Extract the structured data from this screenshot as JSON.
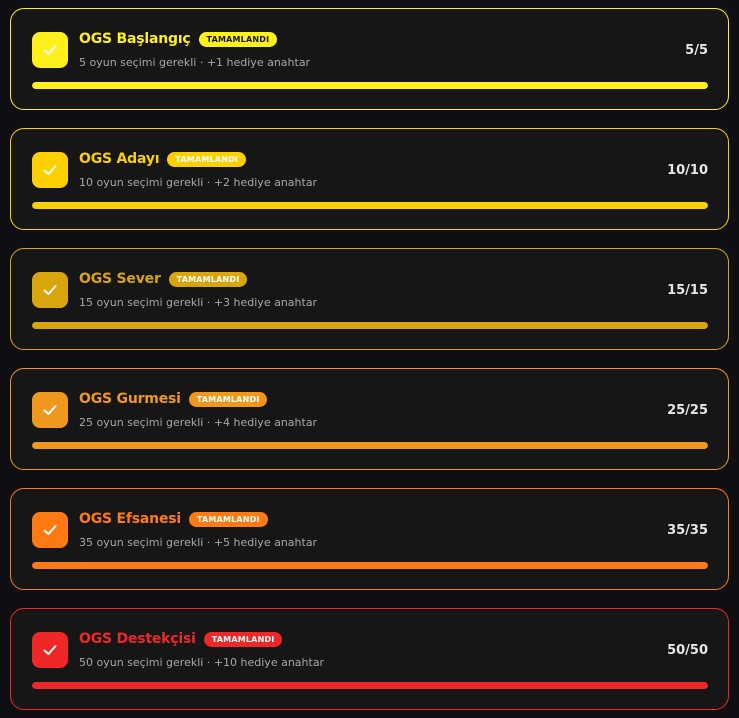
{
  "badge_label": "TAMAMLANDI",
  "levels": [
    {
      "title": "OGS Başlangıç",
      "subtitle": "5 oyun seçimi gerekli · +1 hediye anahtar",
      "count": "5/5",
      "progress": 1.0,
      "color": "#ffef1a",
      "badge_text_color": "#161616"
    },
    {
      "title": "OGS Adayı",
      "subtitle": "10 oyun seçimi gerekli · +2 hediye anahtar",
      "count": "10/10",
      "progress": 1.0,
      "color": "#ffd000",
      "badge_text_color": "#ffffff"
    },
    {
      "title": "OGS Sever",
      "subtitle": "15 oyun seçimi gerekli · +3 hediye anahtar",
      "count": "15/15",
      "progress": 1.0,
      "color": "#d9a50c",
      "badge_text_color": "#ffffff"
    },
    {
      "title": "OGS Gurmesi",
      "subtitle": "25 oyun seçimi gerekli · +4 hediye anahtar",
      "count": "25/25",
      "progress": 1.0,
      "color": "#f0971e",
      "badge_text_color": "#ffffff"
    },
    {
      "title": "OGS Efsanesi",
      "subtitle": "35 oyun seçimi gerekli · +5 hediye anahtar",
      "count": "35/35",
      "progress": 1.0,
      "color": "#ff7a12",
      "badge_text_color": "#ffffff"
    },
    {
      "title": "OGS Destekçisi",
      "subtitle": "50 oyun seçimi gerekli · +10 hediye anahtar",
      "count": "50/50",
      "progress": 1.0,
      "color": "#ef2727",
      "badge_text_color": "#ffffff"
    }
  ],
  "icons": {
    "check": "check-icon"
  }
}
